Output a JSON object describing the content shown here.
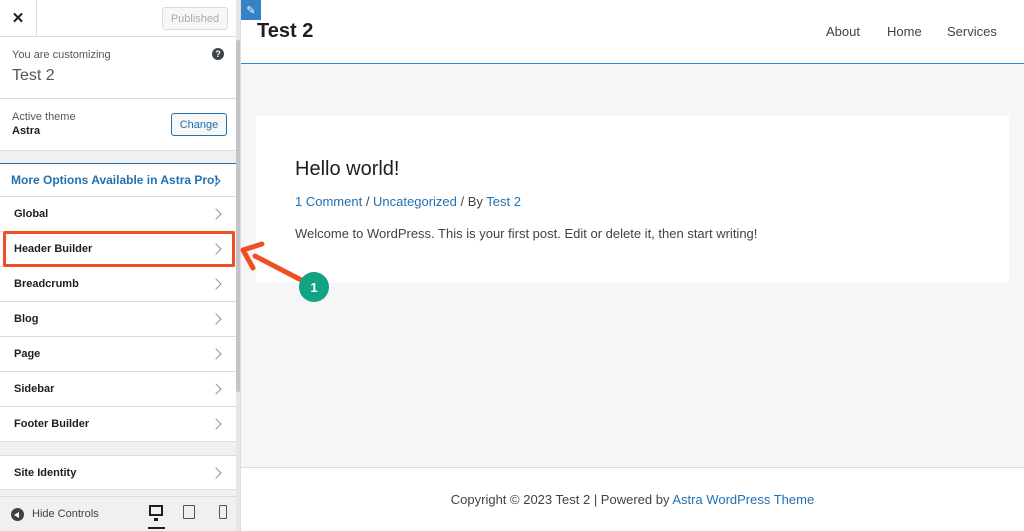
{
  "customizer": {
    "close_icon": "close-icon",
    "published_label": "Published",
    "customizing_label": "You are customizing",
    "customizing_title": "Test 2",
    "help_glyph": "?",
    "active_theme_label": "Active theme",
    "active_theme_name": "Astra",
    "change_label": "Change",
    "promo_label": "More Options Available in Astra Pro!",
    "menu": [
      {
        "label": "Global"
      },
      {
        "label": "Header Builder"
      },
      {
        "label": "Breadcrumb"
      },
      {
        "label": "Blog"
      },
      {
        "label": "Page"
      },
      {
        "label": "Sidebar"
      },
      {
        "label": "Footer Builder"
      },
      {
        "label": "Site Identity"
      }
    ],
    "hide_controls_label": "Hide Controls",
    "devices": [
      "desktop",
      "tablet",
      "mobile"
    ]
  },
  "preview": {
    "edit_glyph": "✎",
    "site_title": "Test 2",
    "nav": [
      {
        "label": "About"
      },
      {
        "label": "Home"
      },
      {
        "label": "Services"
      }
    ],
    "post": {
      "title": "Hello world!",
      "meta_comments": "1 Comment",
      "meta_sep1": " / ",
      "meta_category": "Uncategorized",
      "meta_sep2": " / By ",
      "meta_author": "Test 2",
      "excerpt": "Welcome to WordPress. This is your first post. Edit or delete it, then start writing!"
    },
    "footer": {
      "copyright_text": "Copyright © 2023 Test 2 | Powered by ",
      "theme_link": "Astra WordPress Theme"
    }
  },
  "annotation": {
    "step_number": "1",
    "highlight_color": "#f04e23",
    "badge_color": "#12a385"
  }
}
